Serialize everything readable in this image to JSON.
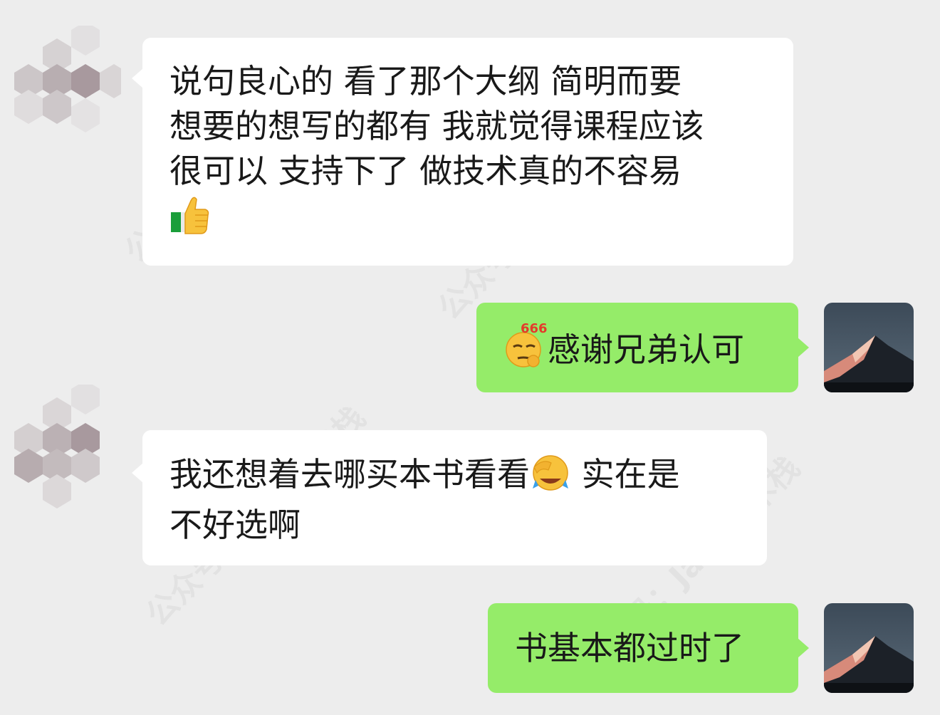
{
  "watermark": "公众号：Java技术栈",
  "messages": [
    {
      "text_line1": "说句良心的 看了那个大纲 简明而要",
      "text_line2": "想要的想写的都有 我就觉得课程应该",
      "text_line3": "很可以 支持下了 做技术真的不容易",
      "emoji": "thumbs-up"
    },
    {
      "text": "感谢兄弟认可",
      "emoji": "666-smirk",
      "emoji_label": "666"
    },
    {
      "text_before": "我还想着去哪买本书看看",
      "text_after": " 实在是",
      "text_line2": "不好选啊",
      "emoji": "facepalm-laugh"
    },
    {
      "text": "书基本都过时了"
    }
  ],
  "colors": {
    "background": "#ededed",
    "incoming": "#ffffff",
    "outgoing": "#95ec69"
  }
}
